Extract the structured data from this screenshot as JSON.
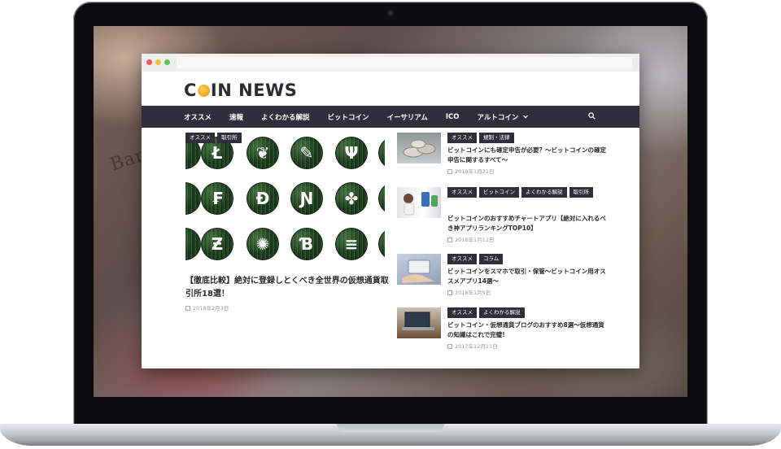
{
  "site": {
    "logo_prefix": "C",
    "logo_suffix": "IN NEWS"
  },
  "nav": {
    "items": [
      "オススメ",
      "速報",
      "よくわかる解説",
      "ビットコイン",
      "イーサリアム",
      "ICO",
      "アルトコイン"
    ],
    "dropdown_index": 6
  },
  "featured": {
    "tags": [
      "オススメ",
      "取引所"
    ],
    "title": "【徹底比較】絶対に登録しとくべき全世界の仮想通貨取引所18選！",
    "date": "2018年2月3日",
    "coin_glyphs": [
      "Ł",
      "❦",
      "✎",
      "Ψ",
      "₣",
      "Ð",
      "Ɲ",
      "✤",
      "Ƶ",
      "✺",
      "Ɓ",
      "≡"
    ]
  },
  "articles": [
    {
      "tags": [
        "オススメ",
        "規制・法律"
      ],
      "title": "ビットコインにも確定申告が必要？〜ビットコインの確定申告に関するすべて〜",
      "date": "2018年1月21日"
    },
    {
      "tags": [
        "オススメ",
        "ビットコイン",
        "よくわかる解説",
        "取引所"
      ],
      "title": "ビットコインのおすすめチャートアプリ【絶対に入れるべき神アプリランキングTOP10】",
      "date": "2018年1月12日"
    },
    {
      "tags": [
        "オススメ",
        "コラム"
      ],
      "title": "ビットコインをスマホで取引・保管〜ビットコイン用オススメアプリ14選〜",
      "date": "2018年1月9日"
    },
    {
      "tags": [
        "オススメ",
        "よくわかる解説"
      ],
      "title": "ビットコイン・仮想通貨ブログのおすすめ8選〜仮想通貨の知識はこれで完璧!",
      "date": "2017年12月21日"
    }
  ],
  "colors": {
    "nav_bg": "#2f2e3a",
    "tag_bg": "#2f2e3a",
    "logo_coin": "#f0a415",
    "coin_green": "#234523"
  },
  "background_text": "Banc"
}
